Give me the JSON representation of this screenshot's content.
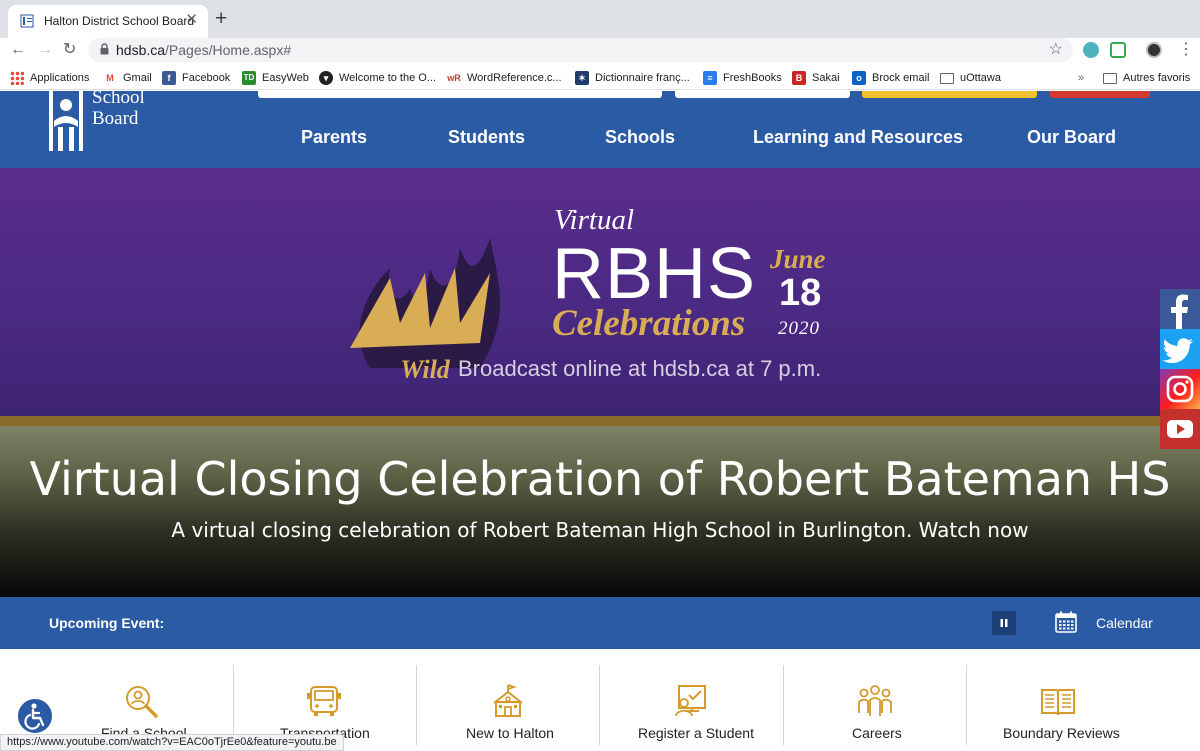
{
  "browser": {
    "tab_title": "Halton District School Board",
    "url_host": "hdsb.ca",
    "url_path": "/Pages/Home.aspx#",
    "status_url": "https://www.youtube.com/watch?v=EAC0oTjrEe0&feature=youtu.be",
    "bookmarks": [
      "Applications",
      "Gmail",
      "Facebook",
      "EasyWeb",
      "Welcome to the O...",
      "WordReference.c...",
      "Dictionnaire franç...",
      "FreshBooks",
      "Sakai",
      "Brock email",
      "uOttawa"
    ],
    "bookmarks_overflow": "»",
    "other_bookmarks": "Autres favoris"
  },
  "site": {
    "logo_line1": "School",
    "logo_line2": "Board",
    "nav": [
      "Parents",
      "Students",
      "Schools",
      "Learning and Resources",
      "Our Board"
    ]
  },
  "hero": {
    "banner_virtual": "Virtual",
    "banner_rbhs": "RBHS",
    "banner_celebrations": "Celebrations",
    "banner_wild": "Wild",
    "banner_month": "June",
    "banner_day": "18",
    "banner_year": "2020",
    "banner_broadcast": "Broadcast online at hdsb.ca at 7 p.m.",
    "title": "Virtual Closing Celebration of Robert Bateman HS",
    "subtitle": "A virtual closing celebration of Robert Bateman High School in Burlington. Watch now"
  },
  "upcoming": {
    "label": "Upcoming Event:",
    "calendar_label": "Calendar"
  },
  "quick_links": [
    {
      "label": "Find a School",
      "icon": "magnifier-user-icon"
    },
    {
      "label": "Transportation",
      "icon": "school-bus-icon"
    },
    {
      "label": "New to Halton",
      "icon": "school-building-icon"
    },
    {
      "label": "Register a Student",
      "icon": "register-student-icon"
    },
    {
      "label": "Careers",
      "icon": "people-group-icon"
    },
    {
      "label": "Boundary Reviews",
      "icon": "open-book-icon"
    }
  ],
  "colors": {
    "brand_blue": "#2c5ba5",
    "hero_purple": "#4b2a83",
    "gold": "#d8ad55",
    "icon_gold": "#d49a2c"
  }
}
